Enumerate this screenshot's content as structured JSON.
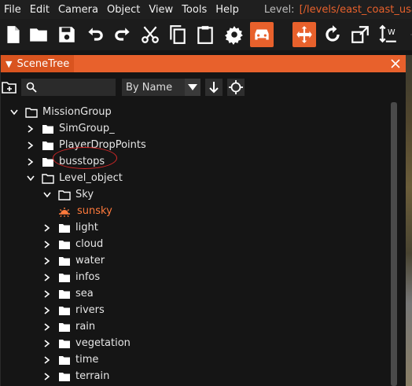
{
  "menu": {
    "items": [
      "File",
      "Edit",
      "Camera",
      "Object",
      "View",
      "Tools",
      "Help"
    ],
    "level_label": "Level:",
    "level_path": "[/levels/east_coast_usa/info.json]"
  },
  "toolbar": {
    "icons": [
      "new-file-icon",
      "open-folder-icon",
      "save-icon",
      "undo-icon",
      "redo-icon",
      "cut-icon",
      "copy-icon",
      "paste-icon",
      "settings-icon",
      "vehicle-icon",
      "move-gizmo-icon",
      "rotate-icon",
      "scale-icon",
      "world-axis-icon",
      "snap-icon"
    ],
    "accent": "#e8612c"
  },
  "panel": {
    "title": "SceneTree",
    "sort_option": "By Name",
    "search_placeholder": ""
  },
  "tree": {
    "rows": [
      {
        "label": "MissionGroup",
        "expanded": true
      },
      {
        "label": "SimGroup_",
        "expanded": false
      },
      {
        "label": "PlayerDropPoints",
        "expanded": false
      },
      {
        "label": "busstops",
        "expanded": false
      },
      {
        "label": "Level_object",
        "expanded": true
      },
      {
        "label": "Sky",
        "expanded": true
      },
      {
        "label": "sunsky",
        "selected": true
      },
      {
        "label": "light",
        "expanded": false
      },
      {
        "label": "cloud",
        "expanded": false
      },
      {
        "label": "water",
        "expanded": false
      },
      {
        "label": "infos",
        "expanded": false
      },
      {
        "label": "sea",
        "expanded": false
      },
      {
        "label": "rivers",
        "expanded": false
      },
      {
        "label": "rain",
        "expanded": false
      },
      {
        "label": "vegetation",
        "expanded": false
      },
      {
        "label": "time",
        "expanded": false
      },
      {
        "label": "terrain",
        "expanded": false
      }
    ],
    "highlight_color": "#ff7a3c"
  }
}
